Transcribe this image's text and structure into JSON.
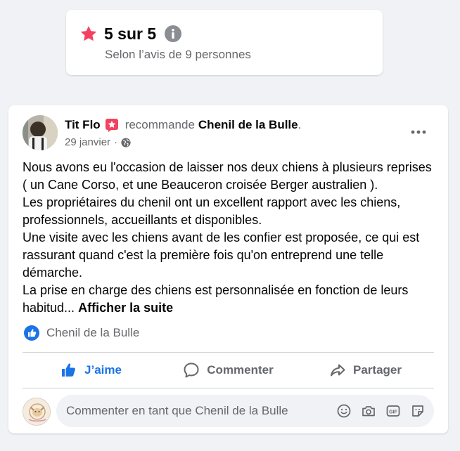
{
  "rating": {
    "score_text": "5 sur 5",
    "subtitle": "Selon l’avis de 9 personnes"
  },
  "post": {
    "author": "Tit Flo",
    "verb": "recommande",
    "page": "Chenil de la Bulle",
    "period": ".",
    "date": "29 janvier",
    "separator": "·",
    "body_paragraphs": [
      "Nous avons eu l'occasion de laisser nos deux chiens à plusieurs reprises ( un Cane Corso, et une Beauceron croisée Berger australien ).",
      "Les propriétaires du chenil ont un excellent rapport avec les chiens, professionnels, accueillants et disponibles.",
      "Une visite avec les chiens avant de les confier est proposée, ce qui est rassurant quand c'est la première fois qu'on entreprend une telle démarche."
    ],
    "body_truncated": "La prise en charge des chiens est personnalisée en fonction de leurs habitud...",
    "see_more": "Afficher la suite",
    "page_tag": "Chenil de la Bulle"
  },
  "actions": {
    "like": "J’aime",
    "comment": "Commenter",
    "share": "Partager"
  },
  "comment": {
    "placeholder": "Commenter en tant que Chenil de la Bulle"
  },
  "colors": {
    "accent_blue": "#1b74e4",
    "star_red": "#f3425f",
    "secondary_text": "#65676b",
    "background": "#f0f2f5"
  },
  "icons": [
    "star-icon",
    "info-icon",
    "recommend-badge-icon",
    "globe-icon",
    "more-icon",
    "like-icon",
    "comment-icon",
    "share-icon",
    "emoji-icon",
    "camera-icon",
    "gif-icon",
    "sticker-icon"
  ]
}
